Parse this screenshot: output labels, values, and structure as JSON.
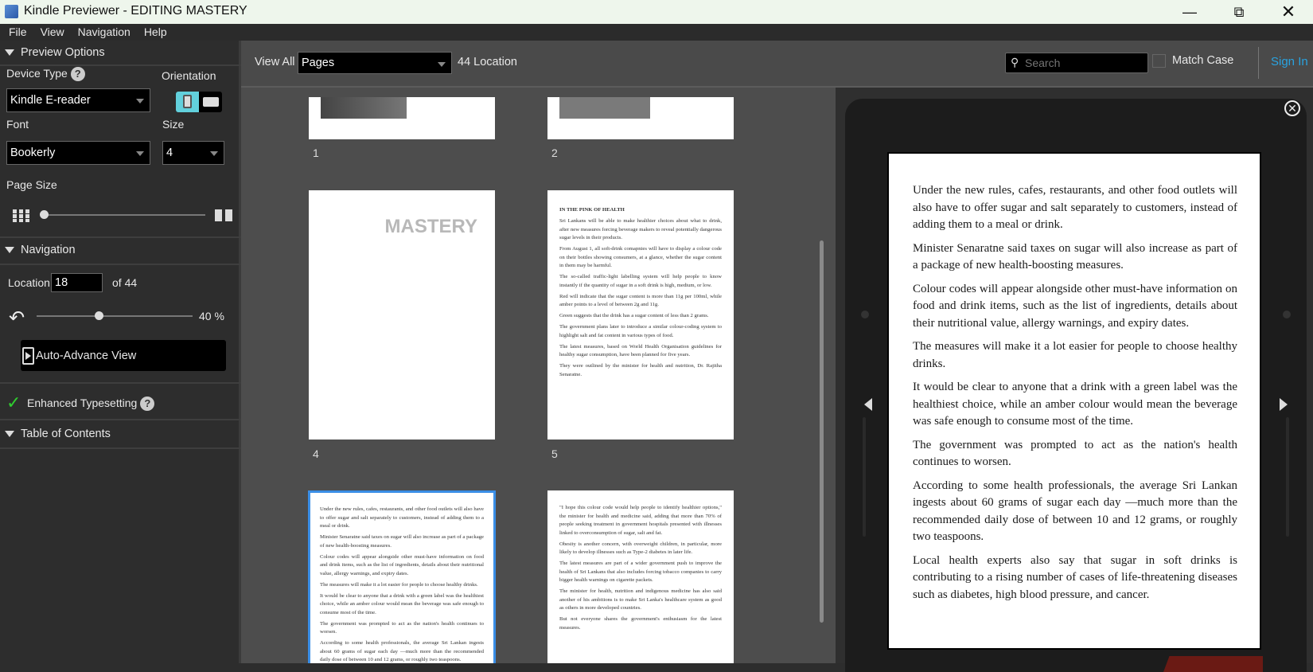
{
  "window": {
    "title": "Kindle Previewer - EDITING MASTERY"
  },
  "menu": [
    "File",
    "View",
    "Navigation",
    "Help"
  ],
  "left": {
    "preview_options": "Preview Options",
    "device_type_label": "Device Type",
    "device_type": "Kindle E-reader",
    "orientation_label": "Orientation",
    "font_label": "Font",
    "font": "Bookerly",
    "size_label": "Size",
    "size": "4",
    "page_size_label": "Page Size",
    "navigation": "Navigation",
    "location_label": "Location",
    "location": "18",
    "of_total": "of 44",
    "progress_label": "40 %",
    "progress": 0.4,
    "auto_advance": "Auto-Advance View",
    "enhanced_typesetting": "Enhanced Typesetting",
    "toc": "Table of Contents",
    "help": "?"
  },
  "toolbar": {
    "view_all": "View All",
    "view_mode": "Pages",
    "location_count": "44 Location",
    "search_placeholder": "Search",
    "match_case": "Match Case",
    "sign_in": "Sign In",
    "accent": "#29a3e0"
  },
  "thumbs": {
    "labels": [
      "1",
      "2",
      "4",
      "5"
    ],
    "p4_title": "MASTERY",
    "p5": [
      "IN THE PINK OF HEALTH",
      "Sri Lankans will be able to make healthier choices about what to drink, after new measures forcing beverage makers to reveal potentially dangerous sugar levels in their products.",
      "From August 1, all soft-drink comapnies will have to display a colour code on their bottles showing consumers, at a glance, whether the sugar content in them may be harmful.",
      "The so-called traffic-light labelling system will help people to know instantly if the quantity of sugar in a soft drink is high, medium, or low.",
      "Red will indicate that the sugar content is more than 11g per 100ml, while amber points to a level of between 2g and 11g.",
      "Green suggests that the drink has a sugar content of less than 2 grams.",
      "The government plans later to introduce a similar colour-coding system to highlight salt and fat content in various types of food.",
      "The latest measures, based on World Health Organisation guidelines for healthy sugar consumption, have been planned for five years.",
      "They were outlined by the minister for health and nutrition, Dr. Rajitha Senaratne."
    ],
    "p7": [
      "\"I hope this colour code would help people to identify healthier options,\" the minister for health and medicine said, adding that more than 70% of people seeking treatment in government hospitals presented with illnesses linked to overconsumption of sugar, salt and fat.",
      "Obesity is another concern, with overweight children, in particular, more likely to develop illnesses such as Type-2 diabetes in later life.",
      "The latest measures are part of a wider government push to improve the health of Sri Lankans that also includes forcing tobacco companies to carry bigger health warnings on cigarette packets.",
      "The minister for health, nutrition and indigenous medicine has also said another of his ambitions is to make Sri Lanka's healthcare system as good as others in more developed countries.",
      "But not everyone shares the government's enthusiasm for the latest measures."
    ]
  },
  "reader": [
    "Under the new rules, cafes, restaurants, and other food outlets will also have to offer sugar and salt separately to customers, instead of adding them to a meal or drink.",
    "Minister Senaratne said taxes on sugar will also  increase as part of a package of new health-boosting measures.",
    "Colour codes will appear alongside other must-have information on food and drink items, such as the list of ingredients, details about their nutritional value, allergy warnings, and expiry dates.",
    "The measures will make it a lot easier for people to choose healthy drinks.",
    "It would be clear to anyone that a drink with a green label was the healthiest choice, while an amber colour would mean the beverage was safe enough to consume most of the time.",
    "The government was prompted to act as the nation's health continues to worsen.",
    "According to some health professionals, the average Sri Lankan ingests about 60 grams of sugar each day —much more than the recommended daily dose of between 10 and 12 grams, or roughly two teaspoons.",
    "Local health experts also say that sugar in soft drinks is contributing to a rising number of cases of life-threatening diseases such as diabetes, high blood pressure, and cancer."
  ]
}
